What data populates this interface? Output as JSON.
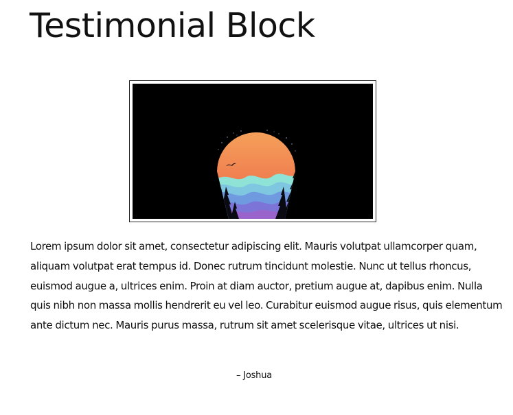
{
  "page": {
    "title": "Testimonial Block"
  },
  "testimonial": {
    "image_description_icon": "sunset-mountain-landscape-image",
    "quote": "Lorem ipsum dolor sit amet, consectetur adipiscing elit. Mauris volutpat ullamcorper quam, aliquam volutpat erat tempus id. Donec rutrum tincidunt molestie. Nunc ut tellus rhoncus, euismod augue a, ultrices enim. Proin at diam auctor, pretium augue at, dapibus enim. Nulla quis nibh non massa mollis hendrerit eu vel leo. Curabitur euismod augue risus, quis elementum ante dictum nec. Mauris purus massa, rutrum sit amet scelerisque vitae, ultrices ut nisi.",
    "author": "– Joshua"
  },
  "colors": {
    "text": "#111111",
    "image_background": "#000000",
    "sun_top": "#f0a050",
    "sun_bottom": "#f06a4a",
    "mountain_teal": "#7fd6cf",
    "mountain_blue": "#6a8fd8",
    "mountain_purple": "#8c6bd4"
  }
}
